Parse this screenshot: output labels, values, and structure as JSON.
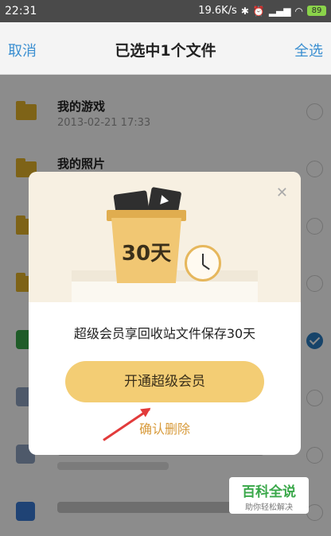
{
  "statusbar": {
    "time": "22:31",
    "speed": "19.6K/s",
    "battery": "89"
  },
  "topbar": {
    "cancel": "取消",
    "title": "已选中1个文件",
    "select_all": "全选"
  },
  "list": [
    {
      "name": "我的游戏",
      "date": "2013-02-21  17:33",
      "checked": false
    },
    {
      "name": "我的照片",
      "date": "",
      "checked": false
    },
    {
      "name": "",
      "date": "",
      "checked": false
    },
    {
      "name": "",
      "date": "",
      "checked": false
    },
    {
      "name": "",
      "date": "",
      "checked": true
    },
    {
      "name": "",
      "date": "",
      "checked": false
    },
    {
      "name": "",
      "date": "",
      "checked": false
    },
    {
      "name": "",
      "date": "",
      "checked": false
    }
  ],
  "modal": {
    "days_label": "30天",
    "description": "超级会员享回收站文件保存30天",
    "vip_button": "开通超级会员",
    "confirm_delete": "确认删除"
  },
  "watermark": {
    "title": "百科全说",
    "subtitle": "助你轻松解决"
  },
  "colors": {
    "accent": "#3b8fd1",
    "vip": "#f3cd74",
    "confirm": "#d89b3c"
  }
}
